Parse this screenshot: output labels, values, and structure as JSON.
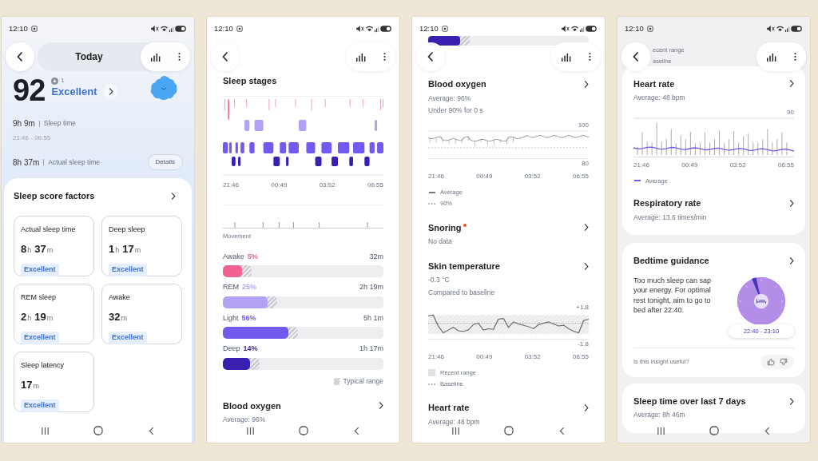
{
  "phones": [
    {
      "status_time": "12:10",
      "header": {
        "title": "Today"
      },
      "sections": [
        {
          "kind": "score",
          "score": "92",
          "change": "1",
          "rating": "Excellent",
          "sleep_value": "9h 9m",
          "sleep_label": "Sleep time",
          "range": "21:46 - 06:55",
          "actual_value": "8h 37m",
          "actual_label": "Actual sleep time",
          "button": "Details"
        },
        {
          "kind": "factors",
          "title": "Sleep score factors",
          "items": [
            {
              "label": "Actual sleep time",
              "value_parts": [
                [
                  "8",
                  "h"
                ],
                [
                  "37",
                  "m"
                ]
              ],
              "rating": "Excellent"
            },
            {
              "label": "Deep sleep",
              "value_parts": [
                [
                  "1",
                  "h"
                ],
                [
                  "17",
                  "m"
                ]
              ],
              "rating": "Excellent"
            },
            {
              "label": "REM sleep",
              "value_parts": [
                [
                  "2",
                  "h"
                ],
                [
                  "19",
                  "m"
                ]
              ],
              "rating": "Excellent"
            },
            {
              "label": "Awake",
              "value_parts": [
                [
                  "32",
                  "m"
                ]
              ],
              "rating": "Excellent"
            },
            {
              "label": "Sleep latency",
              "value_parts": [
                [
                  "17",
                  "m"
                ]
              ],
              "rating": "Excellent"
            }
          ]
        }
      ]
    },
    {
      "status_time": "12:10",
      "sections": [
        {
          "kind": "stages",
          "title": "Sleep stages",
          "times": [
            "21:46",
            "00:49",
            "03:52",
            "06:55"
          ],
          "movement_label": "Movement",
          "legend": "Typical range",
          "bars": [
            {
              "label": "Awake",
              "pct": "5%",
              "duration": "32m",
              "color": "#f06292",
              "level": 0.12
            },
            {
              "label": "REM",
              "pct": "25%",
              "duration": "2h 19m",
              "color": "#b3a2f3",
              "level": 0.28
            },
            {
              "label": "Light",
              "pct": "56%",
              "duration": "5h 1m",
              "color": "#7459ee",
              "level": 0.41
            },
            {
              "label": "Deep",
              "pct": "14%",
              "duration": "1h 17m",
              "color": "#3a1fb0",
              "level": 0.17
            }
          ]
        },
        {
          "kind": "metric",
          "title": "Blood oxygen",
          "lines": [
            "Average: 96%"
          ]
        }
      ]
    },
    {
      "status_time": "12:10",
      "sections": [
        {
          "kind": "bar_fragment",
          "color": "#3a1fb0",
          "level": 0.2
        },
        {
          "kind": "metric",
          "title": "Blood oxygen",
          "lines": [
            "Average: 96%",
            "Under 90% for 0 s"
          ],
          "chart": {
            "kind": "oxygen",
            "y_labels": [
              "100",
              "80"
            ],
            "times": [
              "21:46",
              "00:49",
              "03:52",
              "06:55"
            ]
          },
          "legend": [
            {
              "kind": "line",
              "label": "Average",
              "color": "#777777"
            },
            {
              "kind": "dots",
              "label": "90%"
            }
          ]
        },
        {
          "kind": "metric",
          "title": "Snoring",
          "color": "#f4511e",
          "lines": [
            "No data"
          ]
        },
        {
          "kind": "metric",
          "title": "Skin temperature",
          "lines": [
            "-0.3 °C",
            "Compared to baseline"
          ],
          "chart": {
            "kind": "temperature",
            "y_labels": [
              "+1.8",
              "-1.8"
            ],
            "times": [
              "21:46",
              "00:49",
              "03:52",
              "06:55"
            ]
          },
          "legend": [
            {
              "kind": "swatch",
              "label": "Recent range"
            },
            {
              "kind": "dots",
              "label": "Baseline"
            }
          ]
        },
        {
          "kind": "metric",
          "title": "Heart rate",
          "lines": [
            "Average: 48 bpm"
          ]
        }
      ]
    },
    {
      "status_time": "12:10",
      "sections": [
        {
          "kind": "legend_fragment",
          "items": [
            "ecent range",
            "aseline"
          ]
        },
        {
          "kind": "card",
          "sections": [
            {
              "kind": "metric",
              "title": "Heart rate",
              "lines": [
                "Average: 48 bpm"
              ],
              "chart": {
                "kind": "heart",
                "y_labels": [
                  "90"
                ],
                "times": [
                  "21:46",
                  "00:49",
                  "03:52",
                  "06:55"
                ]
              },
              "legend": [
                {
                  "kind": "line",
                  "label": "Average",
                  "color": "#7459ee"
                }
              ]
            },
            {
              "kind": "metric",
              "title": "Respiratory rate",
              "lines": [
                "Average: 13.6 times/min"
              ]
            }
          ]
        },
        {
          "kind": "guidance",
          "title": "Bedtime guidance",
          "text": "Too much sleep can sap your energy. For optimal rest tonight, aim to go to bed after 22:40.",
          "range": "22:40 - 23:10",
          "question": "Is this insight useful?"
        },
        {
          "kind": "card",
          "sections": [
            {
              "kind": "metric",
              "title": "Sleep time over last 7 days",
              "lines": [
                "Average: 8h 46m"
              ]
            }
          ]
        }
      ]
    }
  ]
}
